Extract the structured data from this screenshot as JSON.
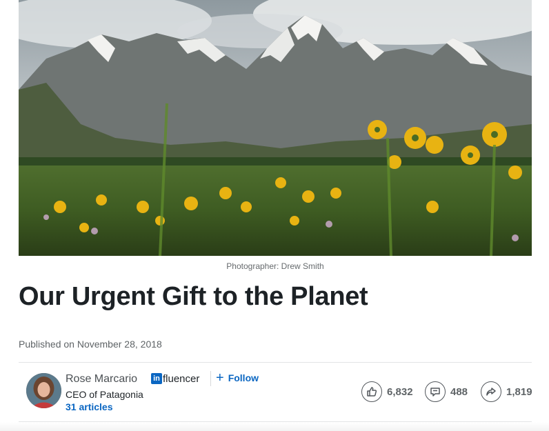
{
  "hero": {
    "caption": "Photographer: Drew Smith"
  },
  "article": {
    "title": "Our Urgent Gift to the Planet",
    "published": "Published on November 28, 2018"
  },
  "author": {
    "name": "Rose Marcario",
    "badge": "fluencer",
    "badge_logo": "in",
    "follow_label": "Follow",
    "job_title": "CEO of Patagonia",
    "articles": "31 articles"
  },
  "stats": {
    "likes": "6,832",
    "comments": "488",
    "shares": "1,819"
  },
  "colors": {
    "link_blue": "#0a66c2",
    "text_dark": "#1d2226",
    "text_muted": "#5e6366"
  },
  "icons": {
    "like": "thumbs-up-icon",
    "comment": "comment-icon",
    "share": "share-arrow-icon",
    "follow": "plus-icon"
  }
}
